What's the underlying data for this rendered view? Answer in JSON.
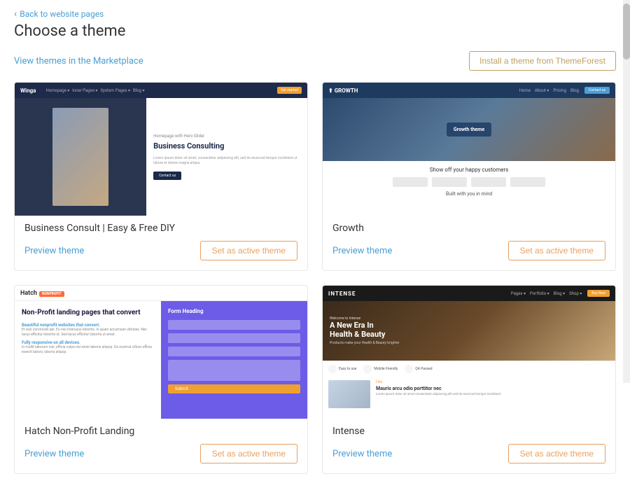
{
  "nav": {
    "back_link": "Back to website pages"
  },
  "header": {
    "title": "Choose a theme"
  },
  "top_bar": {
    "marketplace_link": "View themes in the Marketplace",
    "install_btn": "Install a theme from ThemeForest"
  },
  "themes": [
    {
      "id": "business-consult",
      "name": "Business Consult | Easy & Free DIY",
      "preview_label": "Preview theme",
      "activate_label": "Set as active theme",
      "preview_type": "business"
    },
    {
      "id": "growth",
      "name": "Growth",
      "preview_label": "Preview theme",
      "activate_label": "Set as active theme",
      "preview_type": "growth"
    },
    {
      "id": "hatch",
      "name": "Hatch Non-Profit Landing",
      "preview_label": "Preview theme",
      "activate_label": "Set as active theme",
      "preview_type": "hatch"
    },
    {
      "id": "intense",
      "name": "Intense",
      "preview_label": "Preview theme",
      "activate_label": "Set as active theme",
      "preview_type": "intense"
    }
  ]
}
